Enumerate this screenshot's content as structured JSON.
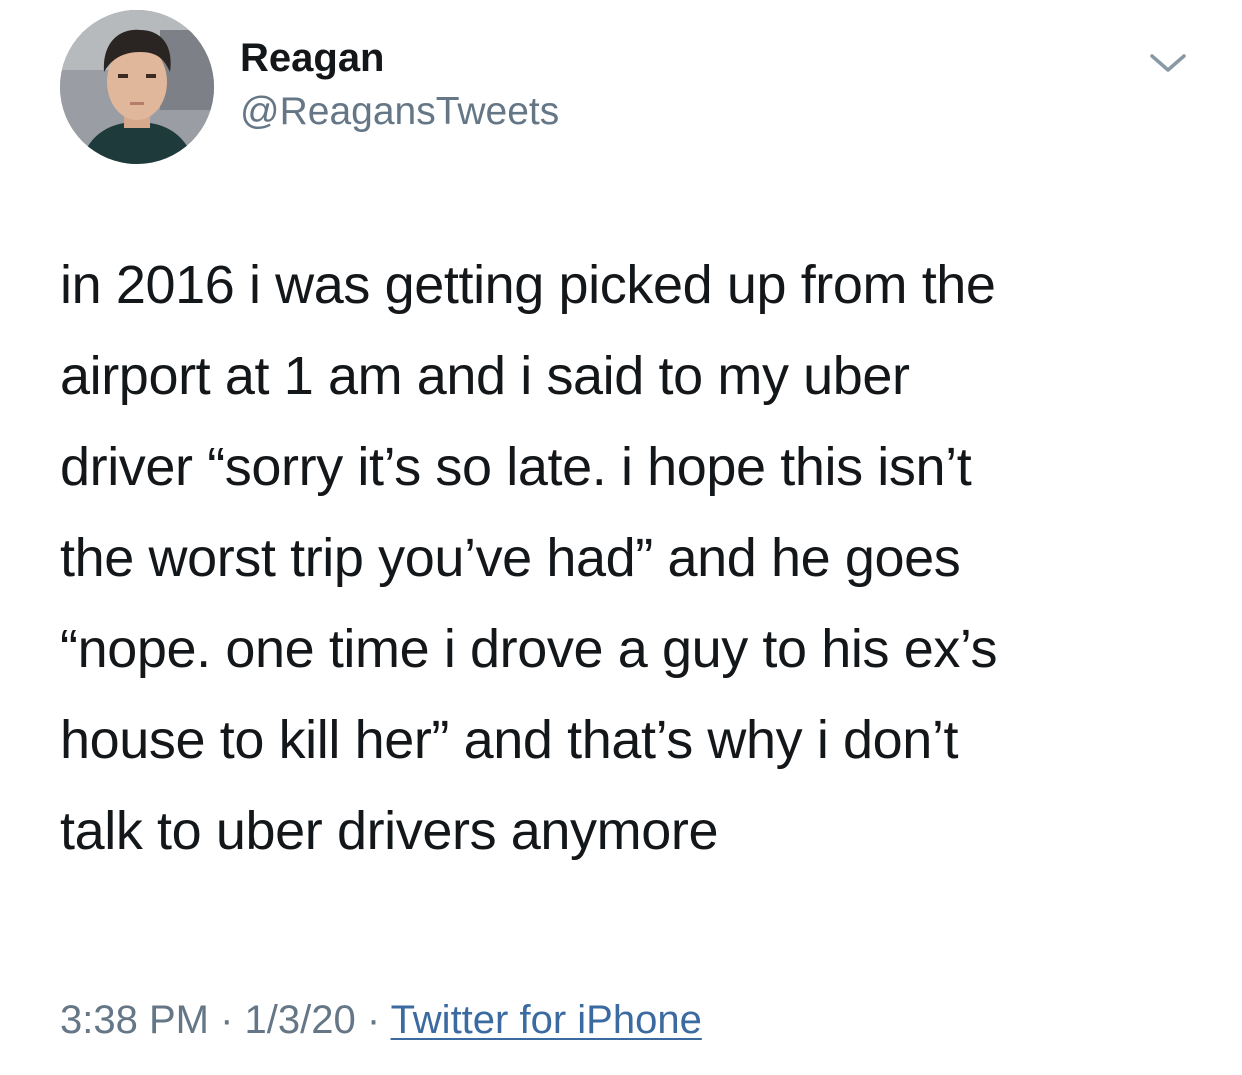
{
  "user": {
    "display_name": "Reagan",
    "handle": "@ReagansTweets"
  },
  "tweet": {
    "lines": [
      "in 2016 i was getting picked up from the",
      "airport at 1 am and i said to my uber",
      "driver “sorry it’s so late. i hope this isn’t",
      "the worst trip you’ve had” and he goes",
      "“nope. one time i drove a guy to his ex’s",
      "house to kill her” and that’s why i don’t",
      "talk to uber drivers anymore"
    ]
  },
  "meta": {
    "time": "3:38 PM",
    "separator": " · ",
    "date": "1/3/20",
    "source": "Twitter for iPhone"
  },
  "icons": {
    "menu": "chevron-down-icon"
  },
  "colors": {
    "text": "#14171a",
    "secondary": "#657786",
    "link": "#3b6aa0"
  }
}
